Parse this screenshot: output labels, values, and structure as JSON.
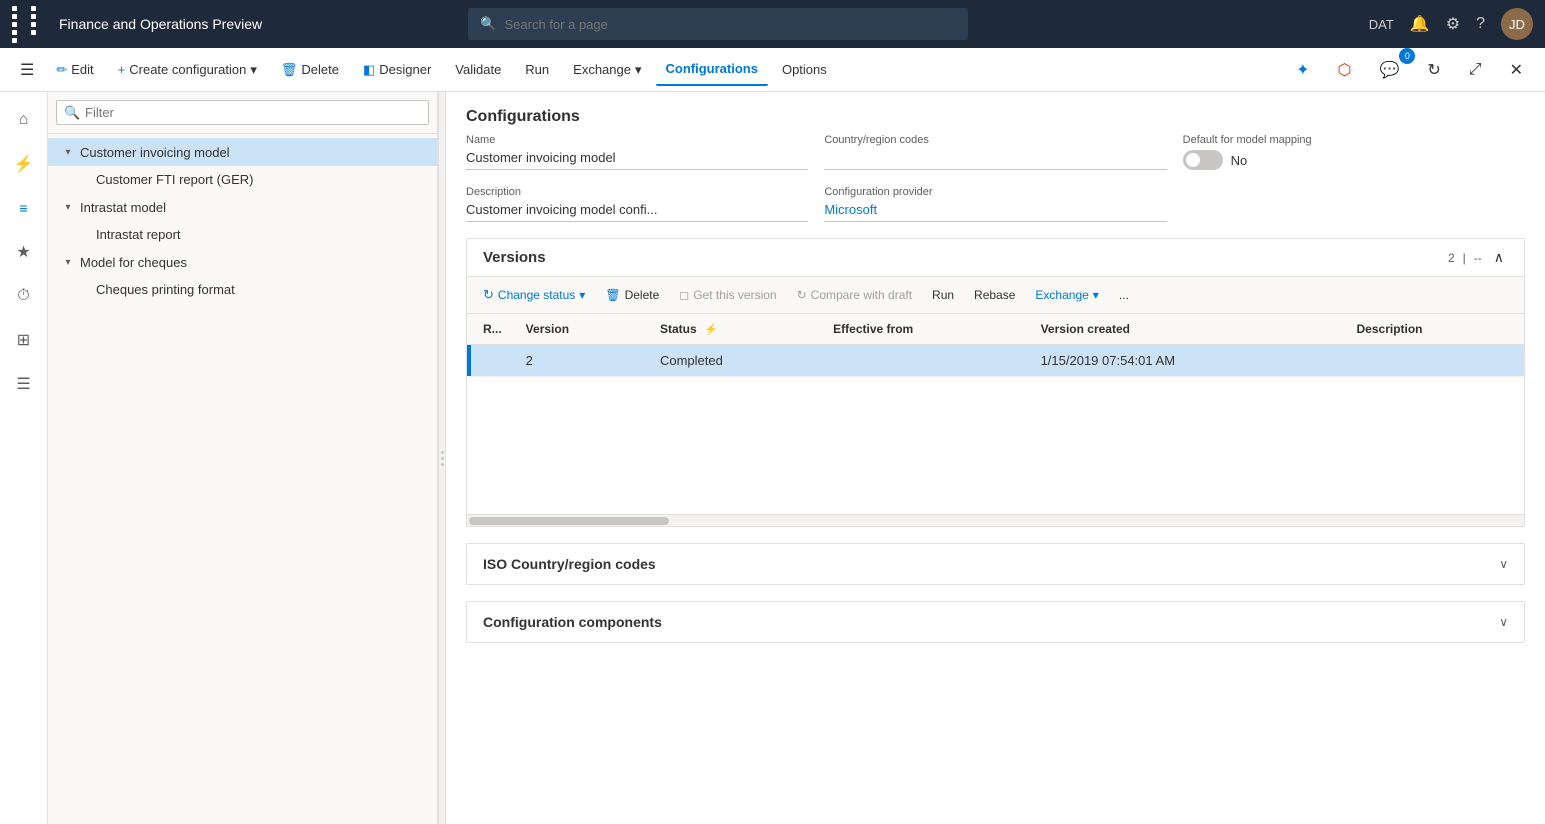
{
  "app": {
    "title": "Finance and Operations Preview",
    "search_placeholder": "Search for a page",
    "user_initials": "JD",
    "env_label": "DAT"
  },
  "command_bar": {
    "edit_label": "Edit",
    "create_label": "Create configuration",
    "delete_label": "Delete",
    "designer_label": "Designer",
    "validate_label": "Validate",
    "run_label": "Run",
    "exchange_label": "Exchange",
    "configurations_label": "Configurations",
    "options_label": "Options"
  },
  "sidebar_icons": [
    {
      "name": "home-icon",
      "symbol": "⌂"
    },
    {
      "name": "favorites-icon",
      "symbol": "★"
    },
    {
      "name": "recent-icon",
      "symbol": "⏱"
    },
    {
      "name": "workspaces-icon",
      "symbol": "⊞"
    },
    {
      "name": "modules-icon",
      "symbol": "≡"
    }
  ],
  "tree": {
    "filter_placeholder": "Filter",
    "items": [
      {
        "label": "Customer invoicing model",
        "level": 0,
        "expanded": true,
        "selected": true,
        "children": [
          {
            "label": "Customer FTI report (GER)",
            "level": 1
          }
        ]
      },
      {
        "label": "Intrastat model",
        "level": 0,
        "expanded": true,
        "children": [
          {
            "label": "Intrastat report",
            "level": 1
          }
        ]
      },
      {
        "label": "Model for cheques",
        "level": 0,
        "expanded": true,
        "children": [
          {
            "label": "Cheques printing format",
            "level": 1
          }
        ]
      }
    ]
  },
  "detail": {
    "section_title": "Configurations",
    "fields": {
      "name_label": "Name",
      "name_value": "Customer invoicing model",
      "country_codes_label": "Country/region codes",
      "country_codes_value": "",
      "default_mapping_label": "Default for model mapping",
      "default_mapping_value": "No",
      "description_label": "Description",
      "description_value": "Customer invoicing model confi...",
      "provider_label": "Configuration provider",
      "provider_value": "Microsoft"
    },
    "versions": {
      "title": "Versions",
      "count": "2",
      "separator": "|",
      "dash": "--",
      "toolbar": {
        "change_status_label": "Change status",
        "delete_label": "Delete",
        "get_version_label": "Get this version",
        "compare_draft_label": "Compare with draft",
        "run_label": "Run",
        "rebase_label": "Rebase",
        "exchange_label": "Exchange",
        "more_label": "..."
      },
      "table": {
        "columns": [
          "R...",
          "Version",
          "Status",
          "Effective from",
          "Version created",
          "Description"
        ],
        "rows": [
          {
            "indicator": true,
            "row_num": "",
            "version": "2",
            "status": "Completed",
            "effective_from": "",
            "version_created": "1/15/2019 07:54:01 AM",
            "description": "",
            "selected": true
          }
        ]
      }
    },
    "iso_section": {
      "title": "ISO Country/region codes"
    },
    "components_section": {
      "title": "Configuration components"
    }
  }
}
